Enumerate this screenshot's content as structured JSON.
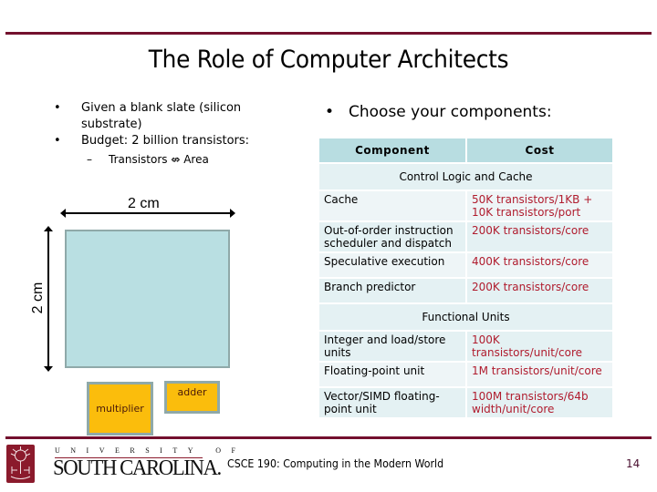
{
  "slide": {
    "title": "The Role of Computer Architects",
    "left_bullets": [
      {
        "marker": "•",
        "text": "Given a blank slate (silicon substrate)"
      },
      {
        "marker": "•",
        "text": "Budget:  2 billion transistors:"
      }
    ],
    "sub_bullet": {
      "marker": "–",
      "text": "Transistors ⇎ Area"
    },
    "right_bullet": {
      "marker": "•",
      "text": "Choose your components:"
    }
  },
  "diagram": {
    "width_label": "2 cm",
    "height_label": "2 cm",
    "units": [
      "multiplier",
      "adder"
    ]
  },
  "table": {
    "headers": [
      "Component",
      "Cost"
    ],
    "sections": [
      {
        "title": "Control Logic and Cache",
        "rows": [
          {
            "component": "Cache",
            "cost": "50K transistors/1KB + 10K transistors/port"
          },
          {
            "component": "Out-of-order instruction scheduler and dispatch",
            "cost": "200K transistors/core"
          },
          {
            "component": "Speculative execution",
            "cost": "400K transistors/core"
          },
          {
            "component": "Branch predictor",
            "cost": "200K transistors/core"
          }
        ]
      },
      {
        "title": "Functional Units",
        "rows": [
          {
            "component": "Integer and load/store units",
            "cost": "100K transistors/unit/core"
          },
          {
            "component": "Floating-point unit",
            "cost": "1M transistors/unit/core"
          },
          {
            "component": "Vector/SIMD floating-point unit",
            "cost": "100M transistors/64b width/unit/core"
          }
        ]
      }
    ]
  },
  "footer": {
    "logo_top": "UNIVERSITY OF",
    "logo_name": "SOUTH CAROLINA.",
    "course": "CSCE 190:  Computing in the Modern World",
    "page_number": "14"
  },
  "colors": {
    "accent": "#73102e",
    "table_header": "#b8dde1",
    "cost_text": "#b01c2e",
    "die_fill": "#b9dfe2",
    "unit_fill": "#fbbd0c"
  }
}
